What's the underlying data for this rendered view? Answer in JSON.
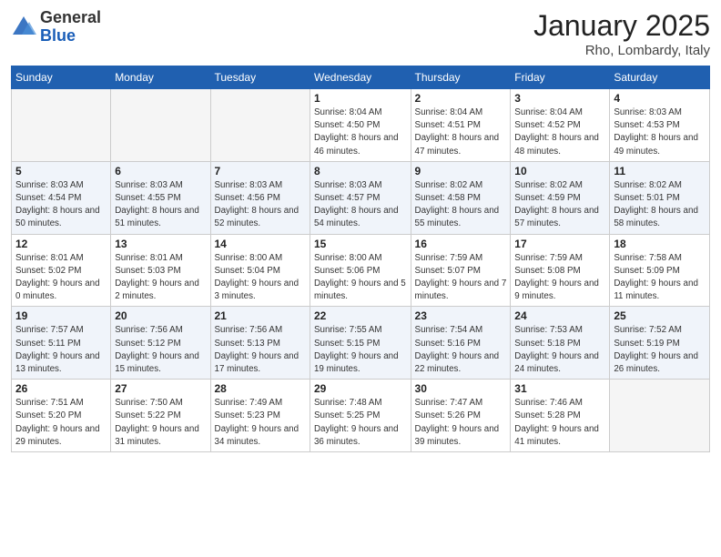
{
  "header": {
    "logo_general": "General",
    "logo_blue": "Blue",
    "title": "January 2025",
    "subtitle": "Rho, Lombardy, Italy"
  },
  "days_of_week": [
    "Sunday",
    "Monday",
    "Tuesday",
    "Wednesday",
    "Thursday",
    "Friday",
    "Saturday"
  ],
  "weeks": [
    {
      "alt": false,
      "days": [
        {
          "num": "",
          "empty": true
        },
        {
          "num": "",
          "empty": true
        },
        {
          "num": "",
          "empty": true
        },
        {
          "num": "1",
          "sunrise": "8:04 AM",
          "sunset": "4:50 PM",
          "daylight": "8 hours and 46 minutes."
        },
        {
          "num": "2",
          "sunrise": "8:04 AM",
          "sunset": "4:51 PM",
          "daylight": "8 hours and 47 minutes."
        },
        {
          "num": "3",
          "sunrise": "8:04 AM",
          "sunset": "4:52 PM",
          "daylight": "8 hours and 48 minutes."
        },
        {
          "num": "4",
          "sunrise": "8:03 AM",
          "sunset": "4:53 PM",
          "daylight": "8 hours and 49 minutes."
        }
      ]
    },
    {
      "alt": true,
      "days": [
        {
          "num": "5",
          "sunrise": "8:03 AM",
          "sunset": "4:54 PM",
          "daylight": "8 hours and 50 minutes."
        },
        {
          "num": "6",
          "sunrise": "8:03 AM",
          "sunset": "4:55 PM",
          "daylight": "8 hours and 51 minutes."
        },
        {
          "num": "7",
          "sunrise": "8:03 AM",
          "sunset": "4:56 PM",
          "daylight": "8 hours and 52 minutes."
        },
        {
          "num": "8",
          "sunrise": "8:03 AM",
          "sunset": "4:57 PM",
          "daylight": "8 hours and 54 minutes."
        },
        {
          "num": "9",
          "sunrise": "8:02 AM",
          "sunset": "4:58 PM",
          "daylight": "8 hours and 55 minutes."
        },
        {
          "num": "10",
          "sunrise": "8:02 AM",
          "sunset": "4:59 PM",
          "daylight": "8 hours and 57 minutes."
        },
        {
          "num": "11",
          "sunrise": "8:02 AM",
          "sunset": "5:01 PM",
          "daylight": "8 hours and 58 minutes."
        }
      ]
    },
    {
      "alt": false,
      "days": [
        {
          "num": "12",
          "sunrise": "8:01 AM",
          "sunset": "5:02 PM",
          "daylight": "9 hours and 0 minutes."
        },
        {
          "num": "13",
          "sunrise": "8:01 AM",
          "sunset": "5:03 PM",
          "daylight": "9 hours and 2 minutes."
        },
        {
          "num": "14",
          "sunrise": "8:00 AM",
          "sunset": "5:04 PM",
          "daylight": "9 hours and 3 minutes."
        },
        {
          "num": "15",
          "sunrise": "8:00 AM",
          "sunset": "5:06 PM",
          "daylight": "9 hours and 5 minutes."
        },
        {
          "num": "16",
          "sunrise": "7:59 AM",
          "sunset": "5:07 PM",
          "daylight": "9 hours and 7 minutes."
        },
        {
          "num": "17",
          "sunrise": "7:59 AM",
          "sunset": "5:08 PM",
          "daylight": "9 hours and 9 minutes."
        },
        {
          "num": "18",
          "sunrise": "7:58 AM",
          "sunset": "5:09 PM",
          "daylight": "9 hours and 11 minutes."
        }
      ]
    },
    {
      "alt": true,
      "days": [
        {
          "num": "19",
          "sunrise": "7:57 AM",
          "sunset": "5:11 PM",
          "daylight": "9 hours and 13 minutes."
        },
        {
          "num": "20",
          "sunrise": "7:56 AM",
          "sunset": "5:12 PM",
          "daylight": "9 hours and 15 minutes."
        },
        {
          "num": "21",
          "sunrise": "7:56 AM",
          "sunset": "5:13 PM",
          "daylight": "9 hours and 17 minutes."
        },
        {
          "num": "22",
          "sunrise": "7:55 AM",
          "sunset": "5:15 PM",
          "daylight": "9 hours and 19 minutes."
        },
        {
          "num": "23",
          "sunrise": "7:54 AM",
          "sunset": "5:16 PM",
          "daylight": "9 hours and 22 minutes."
        },
        {
          "num": "24",
          "sunrise": "7:53 AM",
          "sunset": "5:18 PM",
          "daylight": "9 hours and 24 minutes."
        },
        {
          "num": "25",
          "sunrise": "7:52 AM",
          "sunset": "5:19 PM",
          "daylight": "9 hours and 26 minutes."
        }
      ]
    },
    {
      "alt": false,
      "days": [
        {
          "num": "26",
          "sunrise": "7:51 AM",
          "sunset": "5:20 PM",
          "daylight": "9 hours and 29 minutes."
        },
        {
          "num": "27",
          "sunrise": "7:50 AM",
          "sunset": "5:22 PM",
          "daylight": "9 hours and 31 minutes."
        },
        {
          "num": "28",
          "sunrise": "7:49 AM",
          "sunset": "5:23 PM",
          "daylight": "9 hours and 34 minutes."
        },
        {
          "num": "29",
          "sunrise": "7:48 AM",
          "sunset": "5:25 PM",
          "daylight": "9 hours and 36 minutes."
        },
        {
          "num": "30",
          "sunrise": "7:47 AM",
          "sunset": "5:26 PM",
          "daylight": "9 hours and 39 minutes."
        },
        {
          "num": "31",
          "sunrise": "7:46 AM",
          "sunset": "5:28 PM",
          "daylight": "9 hours and 41 minutes."
        },
        {
          "num": "",
          "empty": true
        }
      ]
    }
  ]
}
